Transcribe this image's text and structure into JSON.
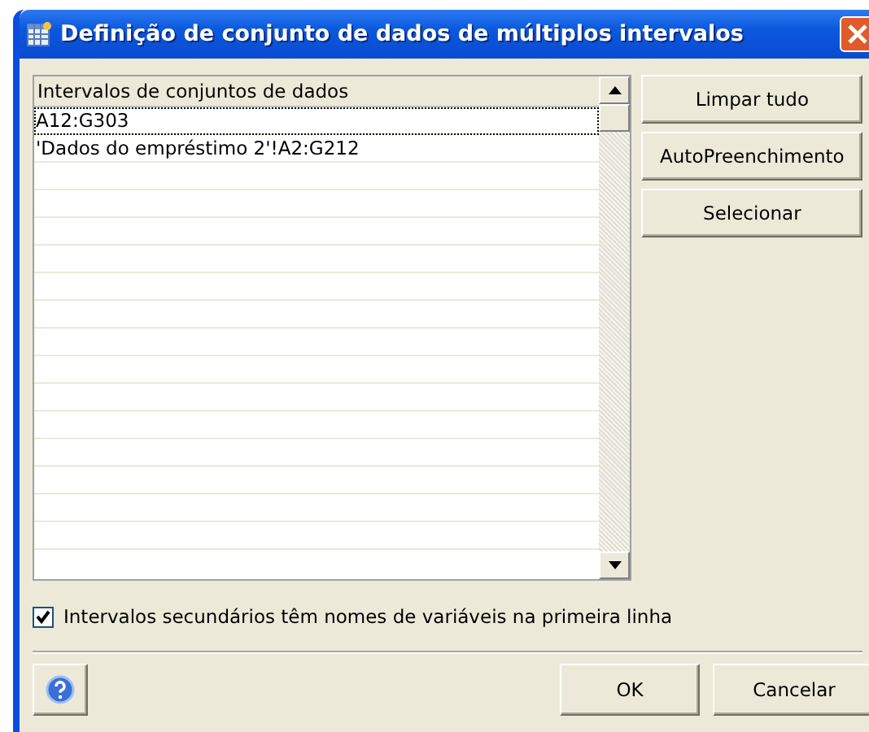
{
  "window": {
    "title": "Definição de conjunto de dados de múltiplos intervalos"
  },
  "list": {
    "header": "Intervalos de conjuntos de dados",
    "rows": [
      {
        "text": "A12:G303",
        "focused": true
      },
      {
        "text": "'Dados do empréstimo 2'!A2:G212",
        "focused": false
      }
    ]
  },
  "side_buttons": [
    "Limpar tudo",
    "AutoPreenchimento",
    "Selecionar"
  ],
  "checkbox": {
    "label": "Intervalos secundários têm nomes de variáveis na primeira linha",
    "checked": true
  },
  "buttons": [
    "OK",
    "Cancelar"
  ]
}
